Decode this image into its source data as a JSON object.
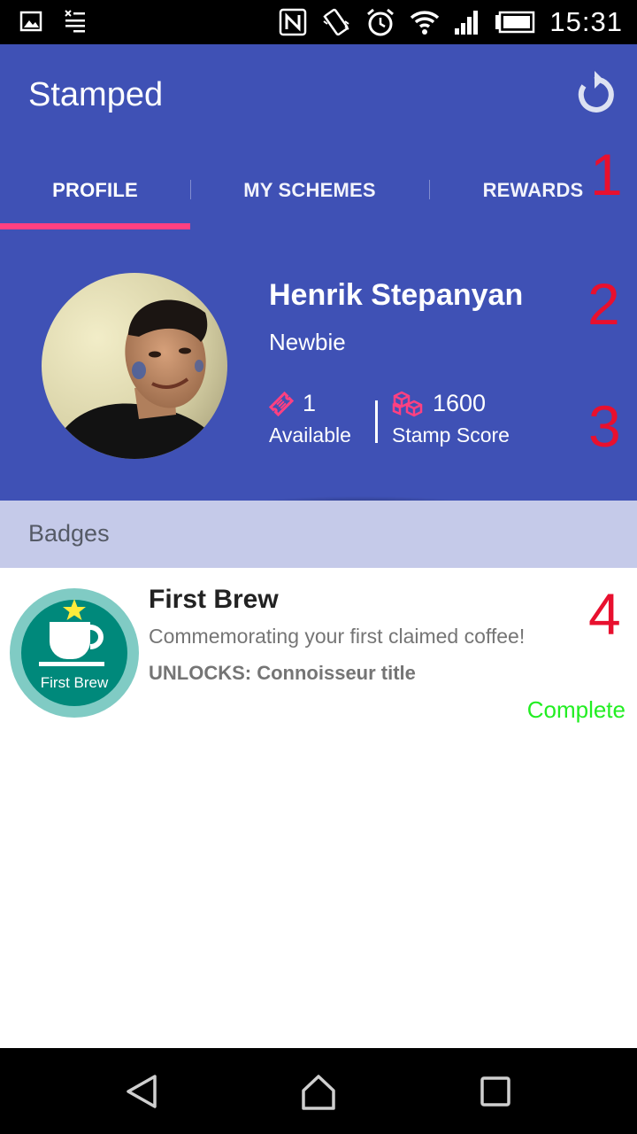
{
  "status_bar": {
    "time": "15:31",
    "icons": [
      "gallery-icon",
      "notes-icon",
      "nfc-icon",
      "vibrate-icon",
      "alarm-icon",
      "wifi-icon",
      "signal-icon",
      "battery-icon"
    ]
  },
  "app_bar": {
    "title": "Stamped",
    "refresh_icon": "refresh-icon"
  },
  "tabs": [
    {
      "label": "PROFILE",
      "selected": true
    },
    {
      "label": "MY SCHEMES",
      "selected": false
    },
    {
      "label": "REWARDS",
      "selected": false
    }
  ],
  "profile": {
    "name": "Henrik Stepanyan",
    "title": "Newbie",
    "available_value": "1",
    "available_label": "Available",
    "score_value": "1600",
    "score_label": "Stamp Score"
  },
  "badges_section": {
    "header": "Badges",
    "items": [
      {
        "icon_text": "First Brew",
        "name": "First Brew",
        "description": "Commemorating your first claimed coffee!",
        "unlocks": "UNLOCKS: Connoisseur title",
        "status": "Complete"
      }
    ]
  },
  "annotations": [
    "1",
    "2",
    "3",
    "4"
  ],
  "colors": {
    "primary": "#3f51b5",
    "accent": "#ff4081",
    "badges_header": "#c5cae9",
    "badge_teal": "#00897b",
    "badge_ring": "#80cbc4",
    "complete": "#22ee22",
    "annotation": "#e8102e"
  }
}
